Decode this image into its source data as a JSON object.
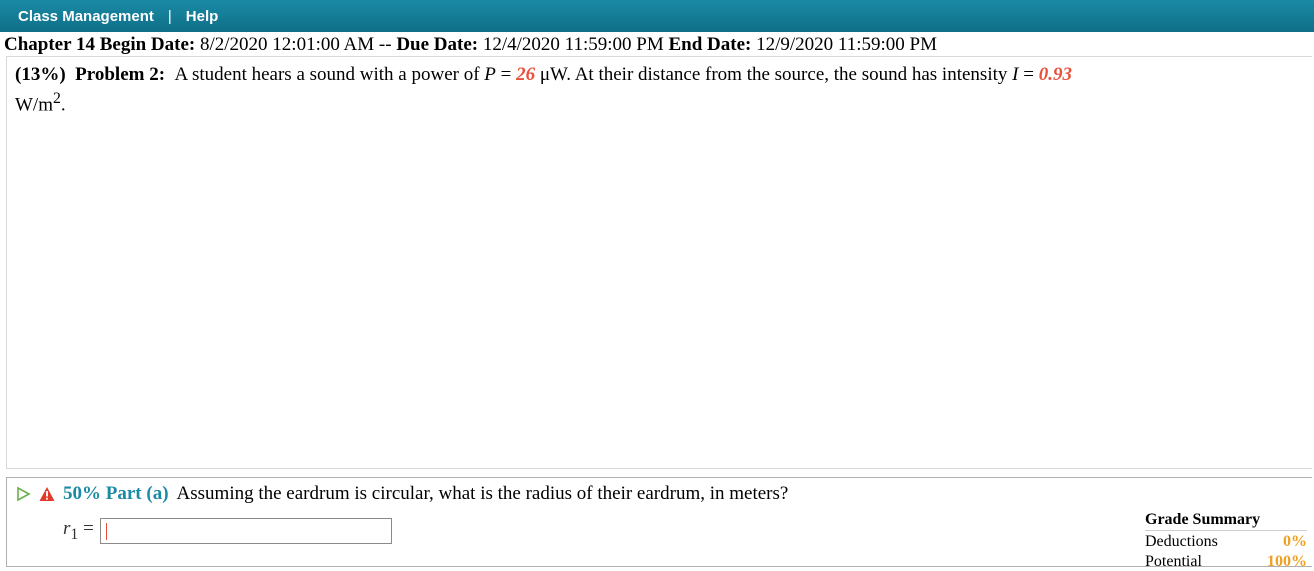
{
  "nav": {
    "class_management": "Class Management",
    "separator": "|",
    "help": "Help"
  },
  "dates": {
    "chapter": "Chapter 14",
    "begin_label": "Begin Date:",
    "begin_value": "8/2/2020 12:01:00 AM",
    "sep": "--",
    "due_label": "Due Date:",
    "due_value": "12/4/2020 11:59:00 PM",
    "end_label": "End Date:",
    "end_value": "12/9/2020 11:59:00 PM"
  },
  "problem": {
    "weight": "(13%)",
    "title": "Problem 2:",
    "text_1": "A student hears a sound with a power of",
    "var_p": "P",
    "eq": " = ",
    "value_p": "26",
    "unit_p": " μW. At their distance from the source, the sound has intensity",
    "var_i": "I",
    "value_i": "0.93",
    "unit_i": "W/m",
    "unit_i_exp": "2",
    "period": "."
  },
  "part_a": {
    "title": "50% Part (a)",
    "question": "Assuming the eardrum is circular, what is the radius of their eardrum, in meters?",
    "var": "r",
    "var_sub": "1",
    "eq": "=",
    "input_value": ""
  },
  "grade_summary": {
    "title": "Grade Summary",
    "deductions_label": "Deductions",
    "deductions_value": "0%",
    "potential_label": "Potential",
    "potential_value": "100%"
  },
  "colors": {
    "header": "#1a8aa5",
    "given_value": "#e8503a",
    "part_title": "#1a8aa5",
    "grade_value": "#f0a020"
  }
}
